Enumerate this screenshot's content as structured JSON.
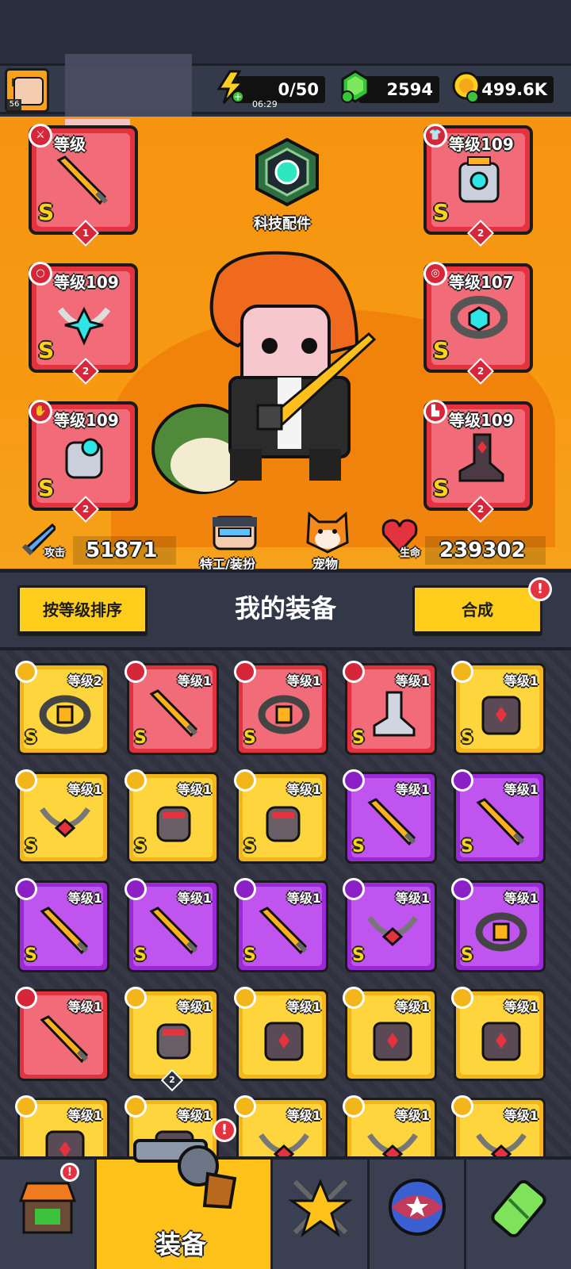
{
  "topbar": {
    "avatar_level": "56",
    "energy": "0/50",
    "energy_timer": "06:29",
    "gems": "2594",
    "gold": "499.6K"
  },
  "hero": {
    "tech_parts_label": "科技配件",
    "slots": [
      {
        "category": "weapon",
        "level": "等级",
        "rank": "S",
        "stars": "1"
      },
      {
        "category": "armor",
        "level": "等级109",
        "rank": "S",
        "stars": "2"
      },
      {
        "category": "necklace",
        "level": "等级109",
        "rank": "S",
        "stars": "2"
      },
      {
        "category": "belt",
        "level": "等级107",
        "rank": "S",
        "stars": "2"
      },
      {
        "category": "glove",
        "level": "等级109",
        "rank": "S",
        "stars": "2"
      },
      {
        "category": "boots",
        "level": "等级109",
        "rank": "S",
        "stars": "2"
      }
    ],
    "attack_label": "攻击",
    "attack_value": "51871",
    "agent_label": "特工/装扮",
    "pet_label": "宠物",
    "hp_label": "生命",
    "hp_value": "239302"
  },
  "midbar": {
    "sort_button": "按等级排序",
    "title": "我的装备",
    "merge_button": "合成",
    "alert": "!"
  },
  "inventory": [
    {
      "color": "yellow",
      "category": "belt",
      "level": "等级2",
      "rank": "S"
    },
    {
      "color": "red",
      "category": "weapon",
      "level": "等级1",
      "rank": "S"
    },
    {
      "color": "red",
      "category": "belt",
      "level": "等级1",
      "rank": "S"
    },
    {
      "color": "red",
      "category": "boots",
      "level": "等级1",
      "rank": "S"
    },
    {
      "color": "yellow",
      "category": "armor",
      "level": "等级1",
      "rank": "S"
    },
    {
      "color": "yellow",
      "category": "necklace",
      "level": "等级1",
      "rank": "S"
    },
    {
      "color": "yellow",
      "category": "glove",
      "level": "等级1",
      "rank": "S"
    },
    {
      "color": "yellow",
      "category": "glove",
      "level": "等级1",
      "rank": "S"
    },
    {
      "color": "purple",
      "category": "weapon",
      "level": "等级1",
      "rank": "S"
    },
    {
      "color": "purple",
      "category": "weapon",
      "level": "等级1",
      "rank": "S"
    },
    {
      "color": "purple",
      "category": "weapon",
      "level": "等级1",
      "rank": "S"
    },
    {
      "color": "purple",
      "category": "weapon",
      "level": "等级1",
      "rank": "S"
    },
    {
      "color": "purple",
      "category": "weapon",
      "level": "等级1",
      "rank": "S"
    },
    {
      "color": "purple",
      "category": "necklace",
      "level": "等级1",
      "rank": "S"
    },
    {
      "color": "purple",
      "category": "belt",
      "level": "等级1",
      "rank": "S"
    },
    {
      "color": "red",
      "category": "weapon",
      "level": "等级1",
      "rank": ""
    },
    {
      "color": "yellow",
      "category": "glove",
      "level": "等级1",
      "rank": "",
      "stars": "2"
    },
    {
      "color": "yellow",
      "category": "armor",
      "level": "等级1",
      "rank": ""
    },
    {
      "color": "yellow",
      "category": "armor",
      "level": "等级1",
      "rank": ""
    },
    {
      "color": "yellow",
      "category": "armor",
      "level": "等级1",
      "rank": ""
    },
    {
      "color": "yellow",
      "category": "armor",
      "level": "等级1",
      "rank": ""
    },
    {
      "color": "yellow",
      "category": "armor",
      "level": "等级1",
      "rank": ""
    },
    {
      "color": "yellow",
      "category": "necklace",
      "level": "等级1",
      "rank": ""
    },
    {
      "color": "yellow",
      "category": "necklace",
      "level": "等级1",
      "rank": ""
    },
    {
      "color": "yellow",
      "category": "necklace",
      "level": "等级1",
      "rank": ""
    }
  ],
  "nav": {
    "equip_label": "装备",
    "alert": "!",
    "tabs": [
      "shop",
      "equipment",
      "battle",
      "gacha",
      "lab"
    ]
  }
}
